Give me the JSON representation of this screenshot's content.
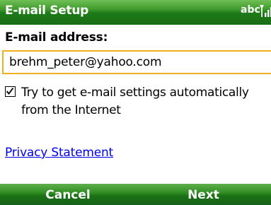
{
  "title_bar": {
    "title": "E-mail Setup",
    "input_mode": "abc",
    "signal_icon": "signal-strength-icon"
  },
  "form": {
    "email_label": "E-mail address:",
    "email_value": "brehm_peter@yahoo.com",
    "auto_settings_checked": true,
    "auto_settings_label": "Try to get e-mail settings automatically from the Internet",
    "privacy_link": "Privacy Statement"
  },
  "softkeys": {
    "left": "Cancel",
    "right": "Next"
  },
  "colors": {
    "bar_green": "#2e8a22",
    "focus_border": "#f0b020",
    "link": "#0000ee"
  }
}
